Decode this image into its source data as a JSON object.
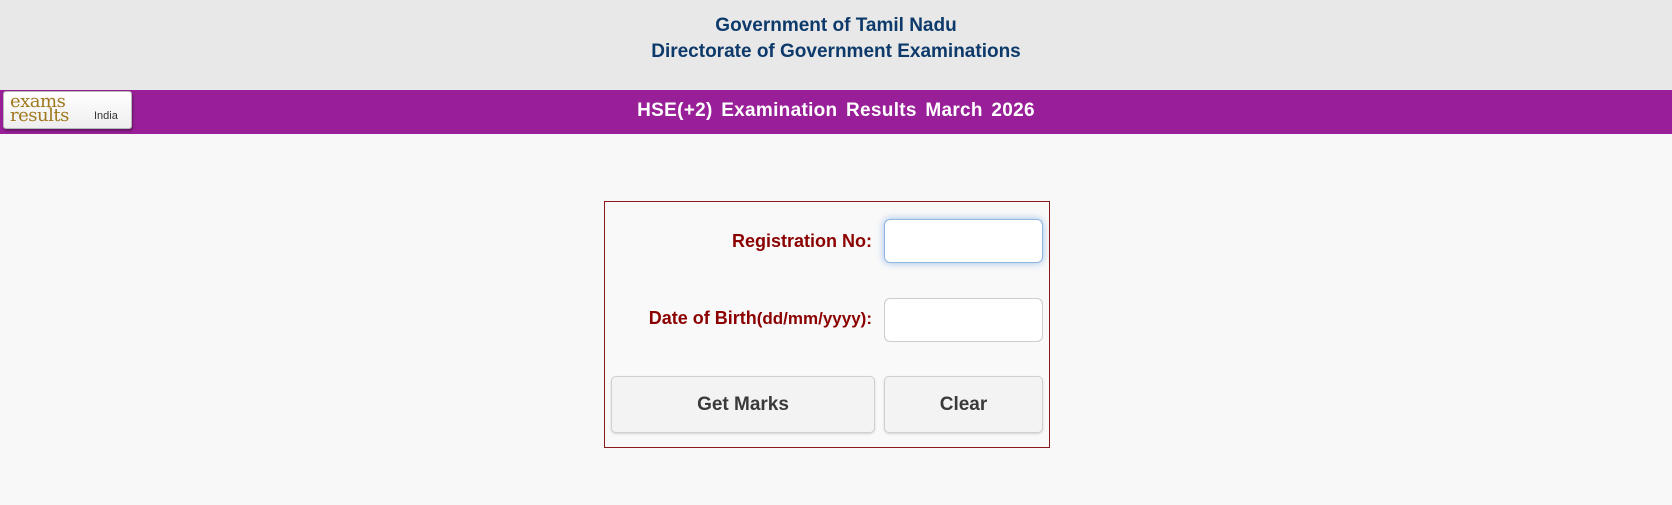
{
  "header": {
    "line1": "Government of Tamil Nadu",
    "line2": "Directorate of Government Examinations"
  },
  "banner": {
    "title": "HSE(+2)  Examination Results  March 2026",
    "background_color": "#991f99"
  },
  "logo": {
    "word1": "exams",
    "word2": "results",
    "word3": "India"
  },
  "form": {
    "registration_label": "Registration No:",
    "registration_value": "",
    "dob_label": "Date of Birth",
    "dob_format": "(dd/mm/yyyy):",
    "dob_value": "",
    "get_marks_label": "Get Marks",
    "clear_label": "Clear",
    "label_color": "#8b0000",
    "border_color": "#8a1a1a"
  }
}
